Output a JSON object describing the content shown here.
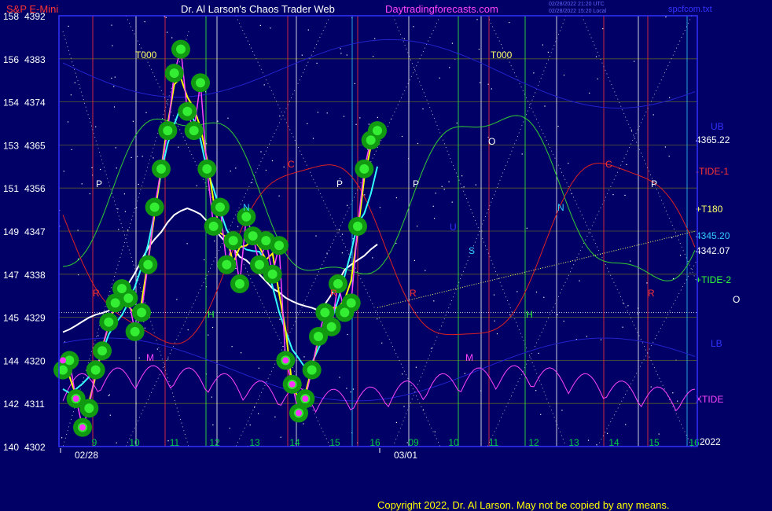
{
  "header": {
    "symbol": "S&P E-Mini",
    "author": "Dr. Al Larson's Chaos Trader Web",
    "site": "Daytradingforecasts.com",
    "stamp_line1": "02/28/2022 21:20 UTC",
    "stamp_line2": "02/28/2022 15:20 Local",
    "file": "spcfcom.txt"
  },
  "footer": {
    "copyright": "Copyright 2022, Dr. Al Larson. May not be copied by any means."
  },
  "chart_data": {
    "type": "line",
    "ylim": [
      4302,
      4392
    ],
    "y_ticks": [
      {
        "left": "158",
        "right": "4392",
        "value": 4392
      },
      {
        "left": "156",
        "right": "4383",
        "value": 4383
      },
      {
        "left": "154",
        "right": "4374",
        "value": 4374
      },
      {
        "left": "153",
        "right": "4365",
        "value": 4365
      },
      {
        "left": "151",
        "right": "4356",
        "value": 4356
      },
      {
        "left": "149",
        "right": "4347",
        "value": 4347
      },
      {
        "left": "147",
        "right": "4338",
        "value": 4338
      },
      {
        "left": "145",
        "right": "4329",
        "value": 4329
      },
      {
        "left": "144",
        "right": "4320",
        "value": 4320
      },
      {
        "left": "142",
        "right": "4311",
        "value": 4311
      },
      {
        "left": "140",
        "right": "4302",
        "value": 4302
      }
    ],
    "x_hour_labels": [
      "9",
      "10",
      "11",
      "12",
      "13",
      "14",
      "15",
      "16",
      "09",
      "10",
      "11",
      "12",
      "13",
      "14",
      "15",
      "16"
    ],
    "x_dates": [
      "02/28",
      "03/01"
    ],
    "year_label": "2022",
    "right_labels": [
      {
        "text": "UB",
        "color": "#3333ff"
      },
      {
        "text": "4365.22",
        "color": "#ffffff"
      },
      {
        "text": "-TIDE-1",
        "color": "#ff3333"
      },
      {
        "text": "+T180",
        "color": "#ffff66"
      },
      {
        "text": "4345.20",
        "color": "#33ccff"
      },
      {
        "text": "4342.07",
        "color": "#ffffff"
      },
      {
        "text": "+TIDE-2",
        "color": "#33ff33"
      },
      {
        "text": "O",
        "color": "#ffffff"
      },
      {
        "text": "LB",
        "color": "#3333ff"
      },
      {
        "text": "XTIDE",
        "color": "#ff44ff"
      }
    ],
    "annotations": [
      {
        "text": "T000",
        "color": "#ffff66"
      },
      {
        "text": "T000",
        "color": "#ffff66"
      },
      {
        "text": "P",
        "color": "#ffffff"
      },
      {
        "text": "P",
        "color": "#ffffff"
      },
      {
        "text": "P",
        "color": "#ffffff"
      },
      {
        "text": "P",
        "color": "#ffffff"
      },
      {
        "text": "O",
        "color": "#ffffff"
      },
      {
        "text": "C",
        "color": "#ff3333"
      },
      {
        "text": "C",
        "color": "#ff3333"
      },
      {
        "text": "N",
        "color": "#33ccff"
      },
      {
        "text": "N",
        "color": "#33ccff"
      },
      {
        "text": "H",
        "color": "#33ff33"
      },
      {
        "text": "H",
        "color": "#33ff33"
      },
      {
        "text": "S",
        "color": "#33ccff"
      },
      {
        "text": "U",
        "color": "#3333ff"
      },
      {
        "text": "M",
        "color": "#ff44ff"
      },
      {
        "text": "M",
        "color": "#ff44ff"
      },
      {
        "text": "R",
        "color": "#ff3333"
      },
      {
        "text": "R",
        "color": "#ff3333"
      },
      {
        "text": "R",
        "color": "#ff3333"
      },
      {
        "text": "R",
        "color": "#ff3333"
      }
    ],
    "series": [
      {
        "name": "price",
        "color": "#ff44ff",
        "values": [
          4318,
          4320,
          4312,
          4306,
          4310,
          4318,
          4322,
          4328,
          4332,
          4335,
          4333,
          4326,
          4330,
          4340,
          4352,
          4360,
          4368,
          4380,
          4385,
          4372,
          4368,
          4378,
          4360,
          4348,
          4352,
          4340,
          4345,
          4336,
          4350,
          4346,
          4340,
          4345,
          4338,
          4344,
          4320,
          4315,
          4309,
          4312,
          4318,
          4325,
          4330,
          4327,
          4336,
          4330,
          4332,
          4348,
          4360,
          4366,
          4368
        ]
      },
      {
        "name": "fast-average",
        "color": "#ffff00"
      },
      {
        "name": "slow-average",
        "color": "#33ffff"
      },
      {
        "name": "mean",
        "color": "#ffffff"
      },
      {
        "name": "+TIDE-2",
        "color": "#33ff33"
      },
      {
        "name": "-TIDE-1",
        "color": "#ff3333"
      },
      {
        "name": "XTIDE",
        "color": "#ff44ff"
      }
    ],
    "t180_start": 4331,
    "t180_end": 4347,
    "zero_level": 4330
  }
}
